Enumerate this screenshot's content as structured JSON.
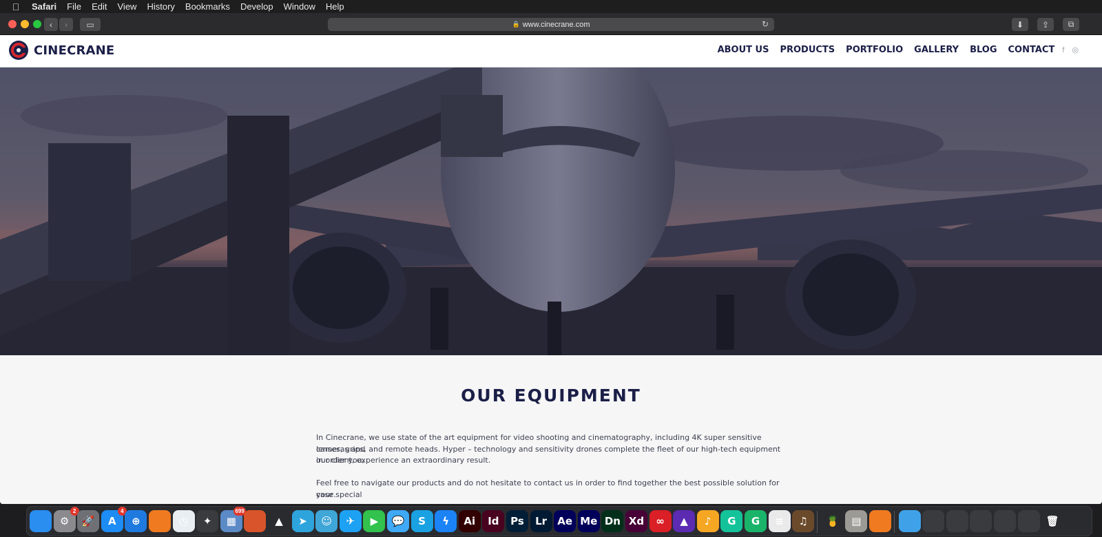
{
  "menubar": {
    "items": [
      {
        "label": "Safari"
      },
      {
        "label": "File"
      },
      {
        "label": "Edit"
      },
      {
        "label": "View"
      },
      {
        "label": "History"
      },
      {
        "label": "Bookmarks"
      },
      {
        "label": "Develop"
      },
      {
        "label": "Window"
      },
      {
        "label": "Help"
      }
    ]
  },
  "browser": {
    "url": "www.cinecrane.com"
  },
  "site": {
    "logo_text": "CINECRANE",
    "nav": [
      {
        "label": "ABOUT US"
      },
      {
        "label": "PRODUCTS"
      },
      {
        "label": "PORTFOLIO"
      },
      {
        "label": "GALLERY"
      },
      {
        "label": "BLOG"
      },
      {
        "label": "CONTACT"
      }
    ],
    "social": [
      {
        "icon": "facebook-icon",
        "glyph": "f"
      },
      {
        "icon": "instagram-icon",
        "glyph": "◎"
      }
    ],
    "brand_colors": {
      "navy": "#1b1f47",
      "red": "#d7262e"
    }
  },
  "section": {
    "title": "OUR EQUIPMENT",
    "paragraph1_line1": "In Cinecrane, we use state of the art equipment for video shooting and cinematography, including 4K super sensitive cameras and",
    "paragraph1_line2": "lenses, grips, and remote heads. Hyper – technology and sensitivity drones complete the fleet of our high-tech equipment in order you,",
    "paragraph1_line3": "our client, experience an extraordinary result.",
    "paragraph2_line1": "Feel free to navigate our products and do not hesitate to contact us in order to find together the best possible solution for your special",
    "paragraph2_line2": "case."
  },
  "dock": {
    "apps": [
      {
        "name": "finder-icon",
        "label": "",
        "bg": "#2a8df0"
      },
      {
        "name": "system-preferences-icon",
        "label": "⚙",
        "bg": "#8a8a8f",
        "badge": "2"
      },
      {
        "name": "launchpad-icon",
        "label": "🚀",
        "bg": "#6f7075"
      },
      {
        "name": "app-store-icon",
        "label": "A",
        "bg": "#1d8cf5",
        "badge": "4"
      },
      {
        "name": "safari-icon",
        "label": "⊕",
        "bg": "#1f7ae0"
      },
      {
        "name": "firefox-icon",
        "label": "",
        "bg": "#f07a20"
      },
      {
        "name": "clock-icon",
        "label": "◷",
        "bg": "#e9eef3"
      },
      {
        "name": "script-editor-icon",
        "label": "✦",
        "bg": "#3a3b3f"
      },
      {
        "name": "preview-icon",
        "label": "▦",
        "bg": "#5b8ac7",
        "badge": "699"
      },
      {
        "name": "rocket-typist-icon",
        "label": "",
        "bg": "#d9542b"
      },
      {
        "name": "vlc-icon",
        "label": "▲",
        "bg": "#2a2b2f"
      },
      {
        "name": "telegram-icon",
        "label": "➤",
        "bg": "#2ea4dd"
      },
      {
        "name": "tweetbot-icon",
        "label": "☺",
        "bg": "#3fa6d8"
      },
      {
        "name": "twitter-icon",
        "label": "✈",
        "bg": "#1da1f2"
      },
      {
        "name": "facetime-icon",
        "label": "▶",
        "bg": "#32c24d"
      },
      {
        "name": "messages-icon",
        "label": "💬",
        "bg": "#3fa9f5"
      },
      {
        "name": "skype-icon",
        "label": "S",
        "bg": "#1aa1e1"
      },
      {
        "name": "messenger-icon",
        "label": "ϟ",
        "bg": "#1b83f5"
      },
      {
        "name": "illustrator-icon",
        "label": "Ai",
        "bg": "#330000"
      },
      {
        "name": "indesign-icon",
        "label": "Id",
        "bg": "#49021f"
      },
      {
        "name": "photoshop-icon",
        "label": "Ps",
        "bg": "#001e36"
      },
      {
        "name": "lightroom-icon",
        "label": "Lr",
        "bg": "#001a33"
      },
      {
        "name": "after-effects-icon",
        "label": "Ae",
        "bg": "#00005b"
      },
      {
        "name": "media-encoder-icon",
        "label": "Me",
        "bg": "#00005b"
      },
      {
        "name": "dimension-icon",
        "label": "Dn",
        "bg": "#012f1a"
      },
      {
        "name": "xd-icon",
        "label": "Xd",
        "bg": "#470137"
      },
      {
        "name": "creative-cloud-icon",
        "label": "∞",
        "bg": "#da1f26"
      },
      {
        "name": "affinity-icon",
        "label": "▲",
        "bg": "#5b2bb2"
      },
      {
        "name": "music-app-icon",
        "label": "♪",
        "bg": "#f5a623"
      },
      {
        "name": "grammarly-icon",
        "label": "G",
        "bg": "#15c39a"
      },
      {
        "name": "grammarly-web-icon",
        "label": "G",
        "bg": "#19b46a"
      },
      {
        "name": "textedit-icon",
        "label": "≡",
        "bg": "#eaeaea"
      },
      {
        "name": "garageband-icon",
        "label": "♫",
        "bg": "#6b4a2c"
      },
      {
        "name": "cocktail-icon",
        "label": "🍍",
        "bg": "#2a2b2f"
      },
      {
        "name": "calculator-icon",
        "label": "▤",
        "bg": "#9c9a94"
      },
      {
        "name": "firefox-dev-icon",
        "label": "",
        "bg": "#f07a20"
      },
      {
        "name": "downloads-folder-icon",
        "label": "",
        "bg": "#3fa2e8"
      },
      {
        "name": "window-thumb-1-icon",
        "label": "",
        "bg": "#3a3b3f"
      },
      {
        "name": "window-thumb-2-icon",
        "label": "",
        "bg": "#3a3b3f"
      },
      {
        "name": "window-thumb-3-icon",
        "label": "",
        "bg": "#3a3b3f"
      },
      {
        "name": "window-thumb-4-icon",
        "label": "",
        "bg": "#3a3b3f"
      },
      {
        "name": "window-thumb-5-icon",
        "label": "",
        "bg": "#3a3b3f"
      },
      {
        "name": "trash-icon",
        "label": "🗑",
        "bg": "#2a2b2f"
      }
    ]
  }
}
